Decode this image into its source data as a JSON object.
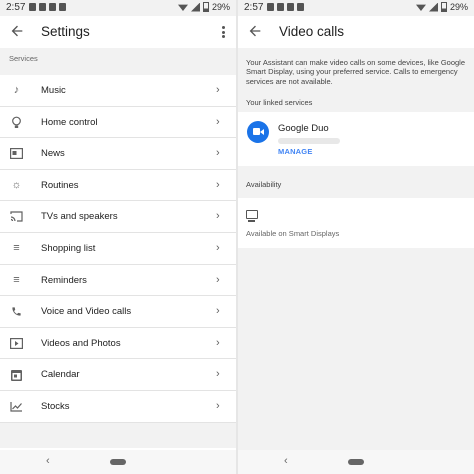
{
  "left": {
    "status": {
      "time": "2:57",
      "battery": "29%"
    },
    "title": "Settings",
    "section_header": "Services",
    "items": [
      {
        "label": "Music",
        "icon": "music-note-icon"
      },
      {
        "label": "Home control",
        "icon": "lightbulb-icon"
      },
      {
        "label": "News",
        "icon": "news-icon"
      },
      {
        "label": "Routines",
        "icon": "routines-sun-icon"
      },
      {
        "label": "TVs and speakers",
        "icon": "cast-icon"
      },
      {
        "label": "Shopping list",
        "icon": "list-icon"
      },
      {
        "label": "Reminders",
        "icon": "reminders-icon"
      },
      {
        "label": "Voice and Video calls",
        "icon": "phone-icon"
      },
      {
        "label": "Videos and Photos",
        "icon": "play-icon"
      },
      {
        "label": "Calendar",
        "icon": "calendar-icon"
      },
      {
        "label": "Stocks",
        "icon": "stocks-chart-icon"
      }
    ]
  },
  "right": {
    "status": {
      "time": "2:57",
      "battery": "29%"
    },
    "title": "Video calls",
    "description": "Your Assistant can make video calls on some devices, like Google Smart Display, using your preferred service. Calls to emergency services are not available.",
    "linked_header": "Your linked services",
    "service": {
      "name": "Google Duo",
      "action": "MANAGE"
    },
    "availability_header": "Availability",
    "availability_text": "Available on Smart Displays"
  },
  "colors": {
    "accent": "#4285f4",
    "duo": "#1a73e8",
    "background": "#f2f2f2"
  }
}
